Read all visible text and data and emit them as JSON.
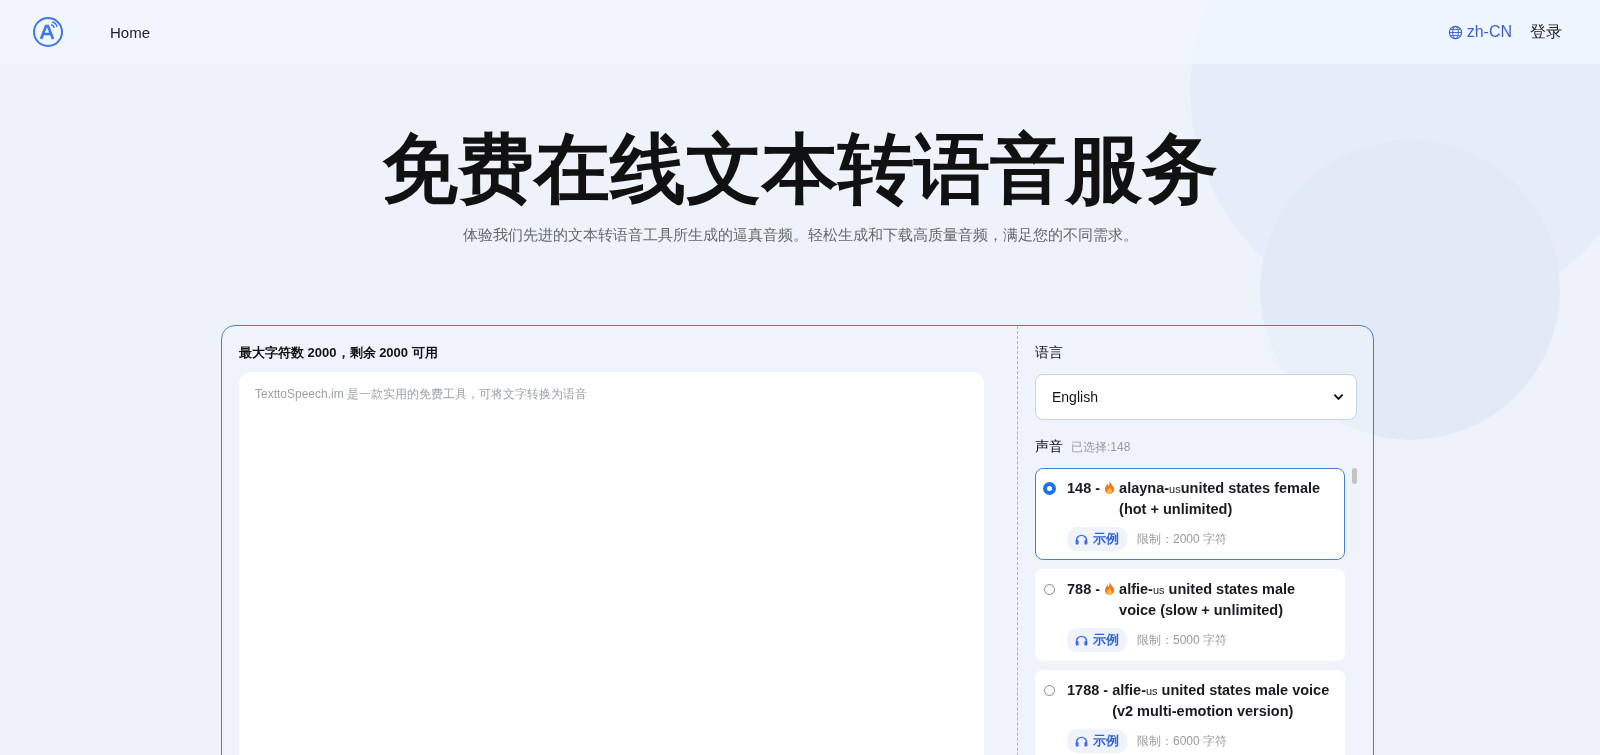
{
  "nav": {
    "home": "Home",
    "language": "zh-CN",
    "language_active": true,
    "login": "登录"
  },
  "hero": {
    "title": "免费在线文本转语音服务",
    "subtitle": "体验我们先进的文本转语音工具所生成的逼真音频。轻松生成和下载高质量音频，满足您的不同需求。"
  },
  "editor": {
    "limit": "最大字符数 2000，剩余 2000 可用",
    "placeholder": "TexttoSpeech.im 是一款实用的免费工具，可将文字转换为语音"
  },
  "settings": {
    "language_label": "语言",
    "language_value": "English",
    "voice_label": "声音",
    "voice_selected": "已选择:148"
  },
  "voices": [
    {
      "number": "148 -",
      "hot": true,
      "name": "alayna-",
      "region": "us",
      "description": "united states female (hot + unlimited)",
      "space": false,
      "selected": true,
      "sample": "示例",
      "limit": "限制：2000 字符"
    },
    {
      "number": "788 -",
      "hot": true,
      "name": "alfie-",
      "region": "us",
      "description": "united states male voice (slow + unlimited)",
      "space": true,
      "selected": false,
      "sample": "示例",
      "limit": "限制：5000 字符"
    },
    {
      "number": "1788 -",
      "hot": false,
      "name": "alfie-",
      "region": "us",
      "description": "united states male voice (v2 multi-emotion version)",
      "space": true,
      "selected": false,
      "sample": "示例",
      "limit": "限制：6000 字符"
    }
  ]
}
